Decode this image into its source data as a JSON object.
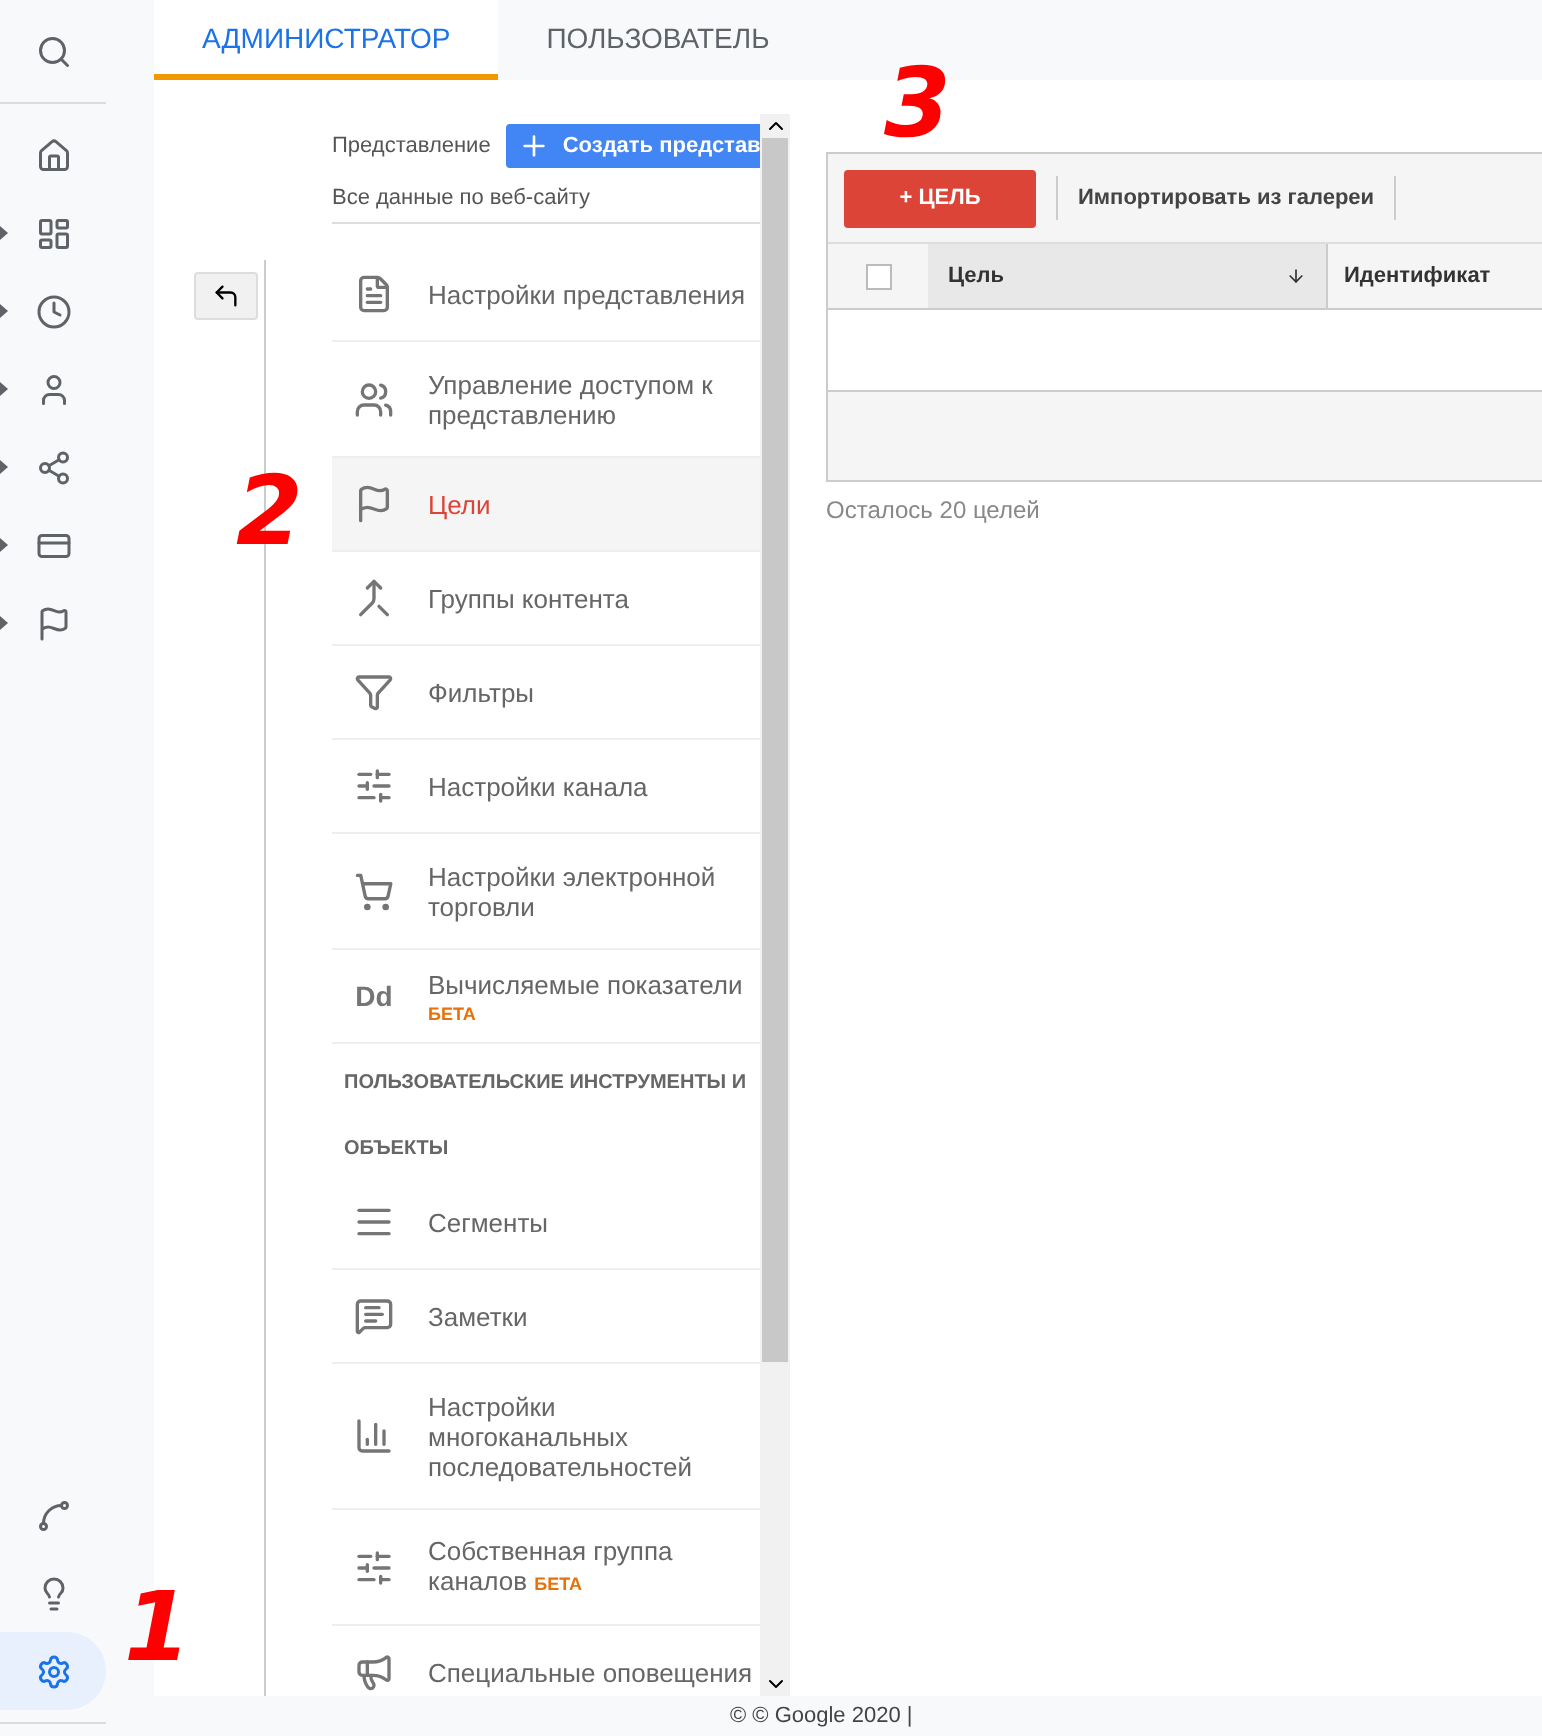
{
  "tabs": [
    {
      "label": "АДМИНИСТРАТОР",
      "selected": true
    },
    {
      "label": "ПОЛЬЗОВАТЕЛЬ",
      "selected": false
    }
  ],
  "rail": {
    "top": [
      {
        "expandable": false,
        "selected": false
      },
      {
        "expandable": false,
        "selected": false
      },
      {
        "expandable": true,
        "selected": false
      },
      {
        "expandable": true,
        "selected": false
      },
      {
        "expandable": true,
        "selected": false
      },
      {
        "expandable": true,
        "selected": false
      },
      {
        "expandable": true,
        "selected": false
      },
      {
        "expandable": true,
        "selected": false
      }
    ],
    "bottom": [
      {
        "expandable": false,
        "selected": false
      },
      {
        "expandable": false,
        "selected": false
      },
      {
        "expandable": false,
        "selected": true
      }
    ]
  },
  "view": {
    "label": "Представление",
    "create_button": "Создать представ",
    "name": "Все данные по веб-сайту"
  },
  "menu": [
    {
      "kind": "item",
      "label": "Настройки представления",
      "selected": false
    },
    {
      "kind": "item",
      "label": "Управление доступом к представлению",
      "selected": false
    },
    {
      "kind": "item",
      "label": "Цели",
      "selected": true
    },
    {
      "kind": "item",
      "label": "Группы контента",
      "selected": false
    },
    {
      "kind": "item",
      "label": "Фильтры",
      "selected": false
    },
    {
      "kind": "item",
      "label": "Настройки канала",
      "selected": false
    },
    {
      "kind": "item",
      "label": "Настройки электронной торговли",
      "selected": false
    },
    {
      "kind": "item",
      "icon_text": "Dd",
      "label": "Вычисляемые показатели",
      "badge": "БЕТА",
      "badge_inline": false,
      "selected": false
    },
    {
      "kind": "section",
      "label": "ПОЛЬЗОВАТЕЛЬСКИЕ ИНСТРУМЕНТЫ И"
    },
    {
      "kind": "section",
      "label": "ОБЪЕКТЫ"
    },
    {
      "kind": "item",
      "label": "Сегменты",
      "selected": false
    },
    {
      "kind": "item",
      "label": "Заметки",
      "selected": false
    },
    {
      "kind": "item",
      "label": "Настройки многоканальных последовательностей",
      "selected": false
    },
    {
      "kind": "item",
      "label": "Собственная группа каналов",
      "badge": "БЕТА",
      "badge_inline": true,
      "selected": false
    },
    {
      "kind": "item",
      "label": "Специальные оповещения",
      "selected": false
    }
  ],
  "goals": {
    "add_button": "+ ЦЕЛЬ",
    "import_button": "Импортировать из галереи",
    "select_all": {
      "checked": false
    },
    "columns": [
      "Цель",
      "Идентификат"
    ],
    "remaining": "Осталось 20 целей"
  },
  "footer": "© © Google 2020 |",
  "annotations": [
    "1",
    "2",
    "3"
  ]
}
